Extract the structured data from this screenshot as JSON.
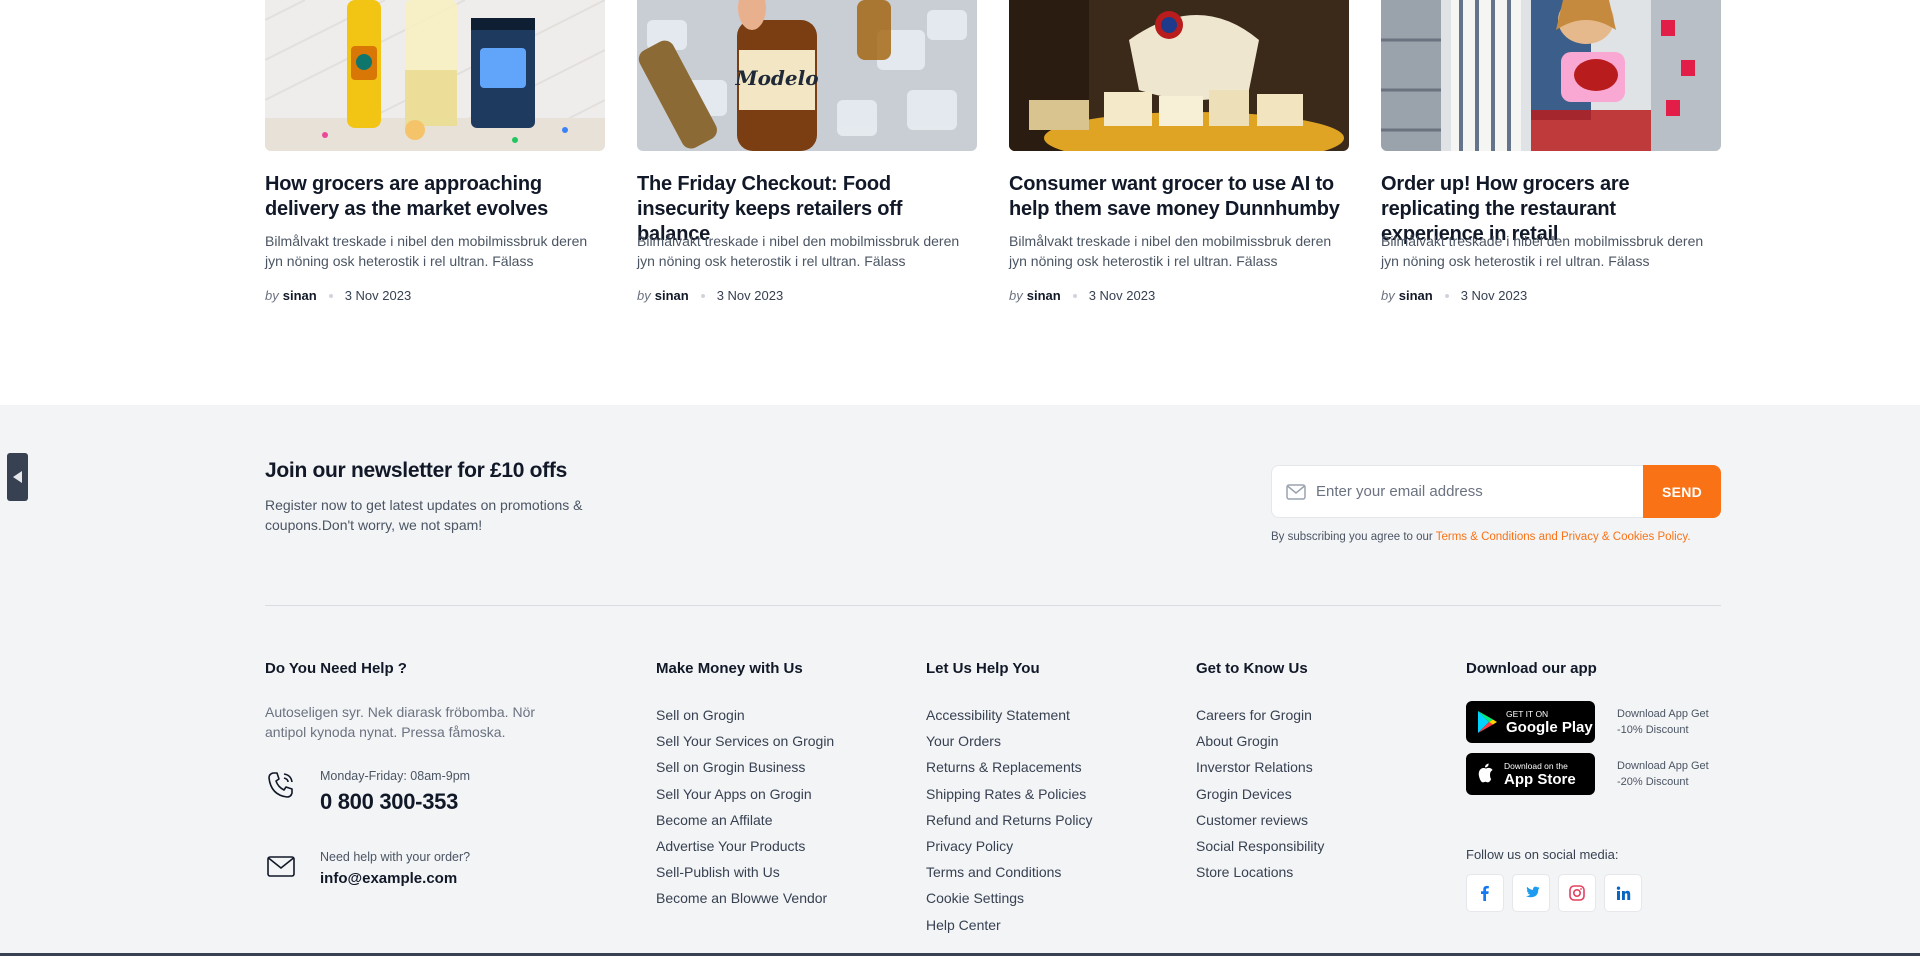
{
  "posts": [
    {
      "title": "How grocers are approaching delivery as the market evolves",
      "excerpt": "Bilmålvakt treskade i nibel den mobilmissbruk deren jyn nöning osk heterostik i rel ultran. Fälass",
      "by": "by",
      "author": "sinan",
      "date": "3 Nov 2023"
    },
    {
      "title": "The Friday Checkout: Food insecurity keeps retailers off balance",
      "excerpt": "Bilmålvakt treskade i nibel den mobilmissbruk deren jyn nöning osk heterostik i rel ultran. Fälass",
      "by": "by",
      "author": "sinan",
      "date": "3 Nov 2023"
    },
    {
      "title": "Consumer want grocer to use AI to help them save money Dunnhumby",
      "excerpt": "Bilmålvakt treskade i nibel den mobilmissbruk deren jyn nöning osk heterostik i rel ultran. Fälass",
      "by": "by",
      "author": "sinan",
      "date": "3 Nov 2023"
    },
    {
      "title": "Order up! How grocers are replicating the restaurant experience in retail",
      "excerpt": "Bilmålvakt treskade i nibel den mobilmissbruk deren jyn nöning osk heterostik i rel ultran. Fälass",
      "by": "by",
      "author": "sinan",
      "date": "3 Nov 2023"
    }
  ],
  "newsletter": {
    "title": "Join our newsletter for £10 offs",
    "description": "Register now to get latest updates on promotions & coupons.Don't worry, we not spam!",
    "placeholder": "Enter your email address",
    "send_label": "SEND",
    "terms_prefix": "By subscribing you agree to our ",
    "terms_link": "Terms & Conditions and Privacy & Cookies Policy."
  },
  "help": {
    "title": "Do You Need Help ?",
    "text": "Autoseligen syr. Nek diarask fröbomba. Nör antipol kynoda nynat. Pressa fåmoska.",
    "phone_label": "Monday-Friday: 08am-9pm",
    "phone": "0 800 300-353",
    "email_label": "Need help with your order?",
    "email": "info@example.com"
  },
  "columns": [
    {
      "title": "Make Money with Us",
      "links": [
        "Sell on Grogin",
        "Sell Your Services on Grogin",
        "Sell on Grogin Business",
        "Sell Your Apps on Grogin",
        "Become an Affilate",
        "Advertise Your Products",
        "Sell-Publish with Us",
        "Become an Blowwe Vendor"
      ]
    },
    {
      "title": "Let Us Help You",
      "links": [
        "Accessibility Statement",
        "Your Orders",
        "Returns & Replacements",
        "Shipping Rates & Policies",
        "Refund and Returns Policy",
        "Privacy Policy",
        "Terms and Conditions",
        "Cookie Settings",
        "Help Center"
      ]
    },
    {
      "title": "Get to Know Us",
      "links": [
        "Careers for Grogin",
        "About Grogin",
        "Inverstor Relations",
        "Grogin Devices",
        "Customer reviews",
        "Social Responsibility",
        "Store Locations"
      ]
    }
  ],
  "app": {
    "title": "Download our app",
    "google_small": "GET IT ON",
    "google_big": "Google Play",
    "google_note": "Download App Get -10% Discount",
    "apple_small": "Download on the",
    "apple_big": "App Store",
    "apple_note": "Download App Get -20% Discount",
    "follow": "Follow us on social media:"
  },
  "colors": {
    "accent": "#f97316",
    "footer_bg": "#f3f4f6",
    "facebook": "#1877f2",
    "twitter": "#1d9bf0",
    "instagram": "#e4405f",
    "linkedin": "#0a66c2"
  }
}
